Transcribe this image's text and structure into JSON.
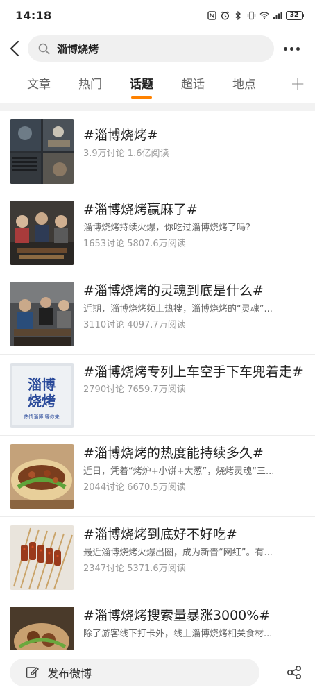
{
  "status": {
    "time": "14:18",
    "battery": "32",
    "icons": [
      "nfc-icon",
      "alarm-icon",
      "bluetooth-icon",
      "vibrate-icon",
      "wifi-icon",
      "signal-icon"
    ]
  },
  "search": {
    "query": "淄博烧烤"
  },
  "tabs": [
    {
      "label": "文章"
    },
    {
      "label": "热门"
    },
    {
      "label": "话题"
    },
    {
      "label": "超话"
    },
    {
      "label": "地点"
    }
  ],
  "tab_plus": "+",
  "topics": [
    {
      "title": "#淄博烧烤#",
      "desc": "",
      "stats": "3.9万讨论 1.6亿阅读"
    },
    {
      "title": "#淄博烧烤赢麻了#",
      "desc": "淄博烧烤持续火爆，你吃过淄博烧烤了吗?",
      "stats": "1653讨论 5807.6万阅读"
    },
    {
      "title": "#淄博烧烤的灵魂到底是什么#",
      "desc": "近期，淄博烧烤频上热搜，淄博烧烤的“灵魂”...",
      "stats": "3110讨论 4097.7万阅读"
    },
    {
      "title": "#淄博烧烤专列上车空手下车兜着走#",
      "desc": "",
      "stats": "2790讨论 7659.7万阅读"
    },
    {
      "title": "#淄博烧烤的热度能持续多久#",
      "desc": "近日，凭着“烤炉+小饼+大葱”，烧烤灵魂“三...",
      "stats": "2044讨论 6670.5万阅读"
    },
    {
      "title": "#淄博烧烤到底好不好吃#",
      "desc": "最近淄博烧烤火爆出圈，成为新晋“网红”。有...",
      "stats": "2347讨论 5371.6万阅读"
    },
    {
      "title": "#淄博烧烤搜索量暴涨3000%#",
      "desc": "除了游客线下打卡外，线上淄博烧烤相关食材...",
      "stats": ""
    }
  ],
  "thumb4": {
    "line1": "淄博",
    "line2": "烧烤",
    "caption": "热情淄博 等你来"
  },
  "bottom": {
    "compose_label": "发布微博"
  },
  "colors": {
    "accent": "#ff8200"
  }
}
